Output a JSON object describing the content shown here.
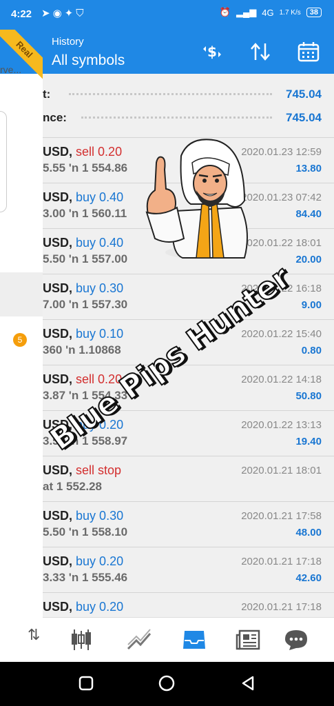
{
  "status_bar": {
    "time": "4:22",
    "network_speed": "1.7 K/s",
    "network_type": "4G",
    "battery": "38"
  },
  "drawer": {
    "real_label": "Real",
    "server_snippet": "rve...",
    "notification_count": "5"
  },
  "app_bar": {
    "subtitle": "History",
    "title": "All symbols"
  },
  "summary": [
    {
      "label": "t:",
      "value": "745.04"
    },
    {
      "label": "nce:",
      "value": "745.04"
    }
  ],
  "trades": [
    {
      "symbol": "USD,",
      "action": "sell 0.20",
      "type": "sell",
      "prices": "5.55 'n  1 554.86",
      "date": "2020.01.23 12:59",
      "profit": "13.80"
    },
    {
      "symbol": "USD,",
      "action": "buy 0.40",
      "type": "buy",
      "prices": "3.00 'n  1 560.11",
      "date": "2020.01.23 07:42",
      "profit": "84.40"
    },
    {
      "symbol": "USD,",
      "action": "buy 0.40",
      "type": "buy",
      "prices": "5.50 'n  1 557.00",
      "date": "2020.01.22 18:01",
      "profit": "20.00"
    },
    {
      "symbol": "USD,",
      "action": "buy 0.30",
      "type": "buy",
      "prices": "7.00 'n  1 557.30",
      "date": "2020.01.22 16:18",
      "profit": "9.00"
    },
    {
      "symbol": "USD,",
      "action": "buy 0.10",
      "type": "buy",
      "prices": "360 'n  1.10868",
      "date": "2020.01.22 15:40",
      "profit": "0.80"
    },
    {
      "symbol": "USD,",
      "action": "sell 0.20",
      "type": "sell",
      "prices": "3.87 'n  1 554.33",
      "date": "2020.01.22 14:18",
      "profit": "50.80"
    },
    {
      "symbol": "USD,",
      "action": "buy 0.20",
      "type": "buy",
      "prices": "3.50 'n  1 558.97",
      "date": "2020.01.22 13:13",
      "profit": "19.40"
    },
    {
      "symbol": "USD,",
      "action": "sell stop",
      "type": "sell",
      "prices": "at 1 552.28",
      "date": "2020.01.21 18:01",
      "profit": ""
    },
    {
      "symbol": "USD,",
      "action": "buy 0.30",
      "type": "buy",
      "prices": "5.50 'n  1 558.10",
      "date": "2020.01.21 17:58",
      "profit": "48.00"
    },
    {
      "symbol": "USD,",
      "action": "buy 0.20",
      "type": "buy",
      "prices": "3.33 'n  1 555.46",
      "date": "2020.01.21 17:18",
      "profit": "42.60"
    },
    {
      "symbol": "USD,",
      "action": "buy 0.20",
      "type": "buy",
      "prices": "",
      "date": "2020.01.21 17:18",
      "profit": ""
    }
  ],
  "watermark": "Blue Pips Hunter",
  "bottom_nav": [
    "quotes-icon",
    "chart-icon",
    "trade-icon",
    "history-icon",
    "news-icon",
    "chat-icon"
  ],
  "colors": {
    "primary": "#1f88e5",
    "buy": "#1976d2",
    "sell": "#d32f2f",
    "ribbon": "#f6b91e"
  }
}
